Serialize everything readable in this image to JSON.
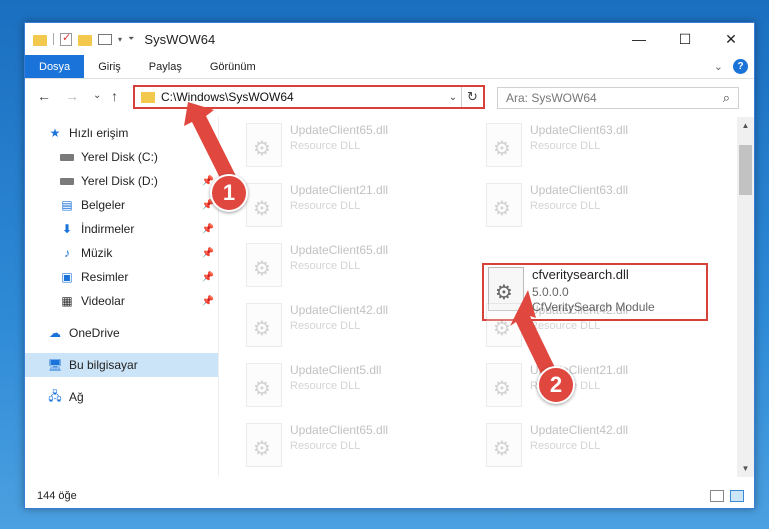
{
  "window": {
    "title": "SysWOW64"
  },
  "window_buttons": {
    "minimize": "—",
    "maximize": "☐",
    "close": "✕"
  },
  "ribbon": {
    "tabs": [
      "Dosya",
      "Giriş",
      "Paylaş",
      "Görünüm"
    ],
    "help": "?"
  },
  "nav": {
    "back": "←",
    "forward": "→",
    "recent": "⌄",
    "up": "↑"
  },
  "address": {
    "path": "C:\\Windows\\SysWOW64",
    "dropdown": "⌄",
    "refresh": "↻"
  },
  "search": {
    "placeholder": "Ara: SysWOW64",
    "icon": "search-icon"
  },
  "sidebar": {
    "items": [
      {
        "label": "Hızlı erişim",
        "icon": "star-icon",
        "pinned": false
      },
      {
        "label": "Yerel Disk (C:)",
        "icon": "drive-icon",
        "pinned": false
      },
      {
        "label": "Yerel Disk (D:)",
        "icon": "drive-icon",
        "pinned": true
      },
      {
        "label": "Belgeler",
        "icon": "document-icon",
        "pinned": true
      },
      {
        "label": "İndirmeler",
        "icon": "download-icon",
        "pinned": true
      },
      {
        "label": "Müzik",
        "icon": "music-icon",
        "pinned": true
      },
      {
        "label": "Resimler",
        "icon": "picture-icon",
        "pinned": true
      },
      {
        "label": "Videolar",
        "icon": "video-icon",
        "pinned": true
      },
      {
        "label": "OneDrive",
        "icon": "cloud-icon",
        "pinned": false
      },
      {
        "label": "Bu bilgisayar",
        "icon": "computer-icon",
        "pinned": false,
        "selected": true
      },
      {
        "label": "Ağ",
        "icon": "network-icon",
        "pinned": false
      }
    ]
  },
  "files": {
    "left": [
      {
        "name": "UpdateClient65.dll",
        "type": "Resource DLL"
      },
      {
        "name": "UpdateClient21.dll",
        "type": "Resource DLL"
      },
      {
        "name": "UpdateClient65.dll",
        "type": "Resource DLL"
      },
      {
        "name": "UpdateClient42.dll",
        "type": "Resource DLL"
      },
      {
        "name": "UpdateClient5.dll",
        "type": "Resource DLL"
      },
      {
        "name": "UpdateClient65.dll",
        "type": "Resource DLL"
      }
    ],
    "right": [
      {
        "name": "UpdateClient63.dll",
        "type": "Resource DLL"
      },
      {
        "name": "UpdateClient63.dll",
        "type": "Resource DLL"
      },
      {
        "name": "cfveritysearch.dll",
        "version": "5.0.0.0",
        "type": "CfVeritySearch Module",
        "highlight": true
      },
      {
        "name": "UpdateClient42.dll",
        "type": "Resource DLL"
      },
      {
        "name": "UpdateClient21.dll",
        "type": "Resource DLL"
      },
      {
        "name": "UpdateClient42.dll",
        "type": "Resource DLL"
      }
    ]
  },
  "status": {
    "count": "144 öğe"
  },
  "annotations": {
    "step1": "1",
    "step2": "2",
    "color": "#e0483f"
  }
}
